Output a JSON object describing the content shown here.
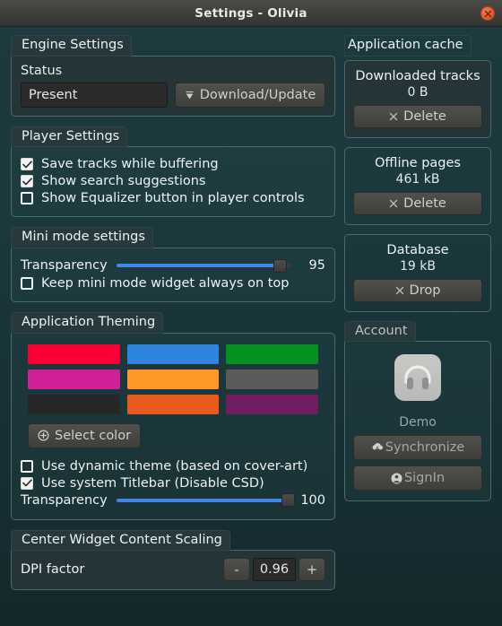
{
  "window": {
    "title": "Settings - Olivia",
    "close_icon": "close-icon"
  },
  "engine_settings": {
    "group_label": "Engine Settings",
    "status_label": "Status",
    "status_value": "Present",
    "download_button": "Download/Update",
    "download_icon": "download-arrow-icon"
  },
  "player_settings": {
    "group_label": "Player Settings",
    "items": [
      {
        "label": "Save tracks while buffering",
        "checked": true
      },
      {
        "label": "Show search suggestions",
        "checked": true
      },
      {
        "label": "Show Equalizer button in player controls",
        "checked": false
      }
    ]
  },
  "mini_mode": {
    "group_label": "Mini mode settings",
    "transparency_label": "Transparency",
    "transparency_value": 95,
    "transparency_min": 0,
    "transparency_max": 100,
    "always_on_top": {
      "label": "Keep mini mode widget always on top",
      "checked": false
    }
  },
  "theming": {
    "group_label": "Application Theming",
    "swatches": [
      "#fb0038",
      "#2f85dd",
      "#049120",
      "#cf2195",
      "#fd9826",
      "#5b5b59",
      "#272727",
      "#e85a1e",
      "#6e1f61"
    ],
    "select_color_button": "Select color",
    "select_color_icon": "plus-circle-icon",
    "dynamic_theme": {
      "label": "Use dynamic theme (based on cover-art)",
      "checked": false
    },
    "system_titlebar": {
      "label": "Use system Titlebar (Disable CSD)",
      "checked": true
    },
    "transparency_label": "Transparency",
    "transparency_value": 100,
    "transparency_min": 0,
    "transparency_max": 100
  },
  "scaling": {
    "group_label": "Center Widget Content Scaling",
    "dpi_label": "DPI factor",
    "dpi_value": "0.96",
    "decrement_label": "-",
    "increment_label": "+"
  },
  "cache": {
    "group_label": "Application cache",
    "cards": [
      {
        "title": "Downloaded tracks",
        "size": "0 B",
        "button": "Delete",
        "icon": "x-icon"
      },
      {
        "title": "Offline pages",
        "size": "461 kB",
        "button": "Delete",
        "icon": "x-icon"
      },
      {
        "title": "Database",
        "size": "19 kB",
        "button": "Drop",
        "icon": "x-icon"
      }
    ]
  },
  "account": {
    "group_label": "Account",
    "avatar_icon": "headphones-avatar-icon",
    "name": "Demo",
    "sync_button": "Synchronize",
    "sync_icon": "cloud-download-icon",
    "signin_button": "SignIn",
    "signin_icon": "person-circle-icon"
  }
}
